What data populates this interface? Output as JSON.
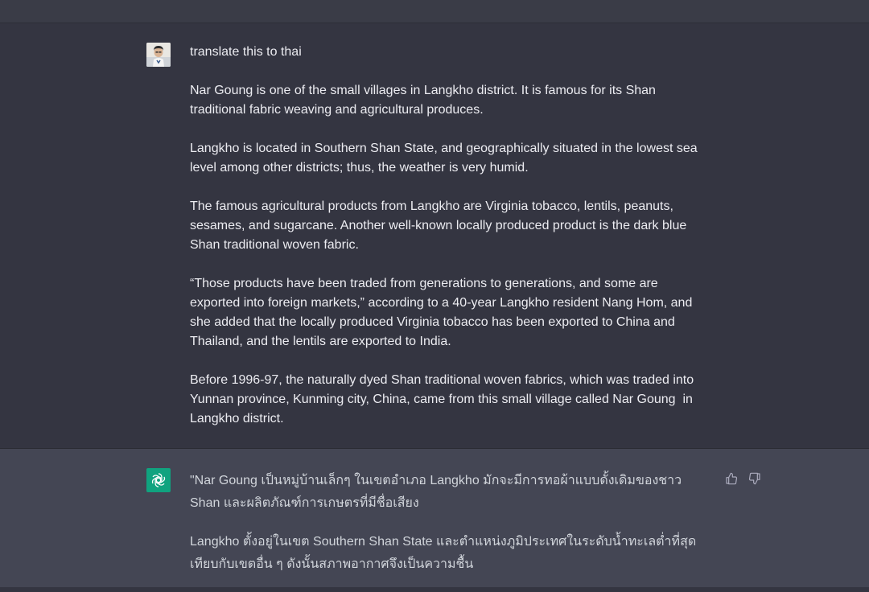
{
  "user_message": {
    "paragraphs": [
      "translate this to thai",
      "Nar Goung is one of the small villages in Langkho district. It is famous for its Shan traditional fabric weaving and agricultural produces.",
      "Langkho is located in Southern Shan State, and geographically situated in the lowest sea level among other districts; thus, the weather is very humid.",
      "The famous agricultural products from Langkho are Virginia tobacco, lentils, peanuts, sesames, and sugarcane. Another well-known locally produced product is the dark blue Shan traditional woven fabric.",
      "“Those products have been traded from generations to generations, and some are exported into foreign markets,” according to a 40-year Langkho resident Nang Hom, and she added that the locally produced Virginia tobacco has been exported to China and Thailand, and the lentils are exported to India.",
      "Before 1996-97, the naturally dyed Shan traditional woven fabrics, which was traded into Yunnan province, Kunming city, China, came from this small village called Nar Goung  in Langkho district."
    ]
  },
  "assistant_message": {
    "paragraphs": [
      "\"Nar Goung เป็นหมู่บ้านเล็กๆ ในเขตอำเภอ Langkho มักจะมีการทอผ้าแบบดั้งเดิมของชาว Shan และผลิตภัณฑ์การเกษตรที่มีชื่อเสียง",
      "Langkho ตั้งอยู่ในเขต Southern Shan State และตำแหน่งภูมิประเทศในระดับน้ำทะเลต่ำที่สุดเทียบกับเขตอื่น ๆ ดังนั้นสภาพอากาศจึงเป็นความชื้น"
    ]
  },
  "icons": {
    "user_avatar": "user-avatar-photo",
    "assistant_avatar": "openai-logo-icon",
    "thumbs_up": "thumbs-up-icon",
    "thumbs_down": "thumbs-down-icon"
  },
  "colors": {
    "background": "#343541",
    "assistant_background": "#444654",
    "assistant_avatar": "#10a37f",
    "text": "#ececf1"
  }
}
